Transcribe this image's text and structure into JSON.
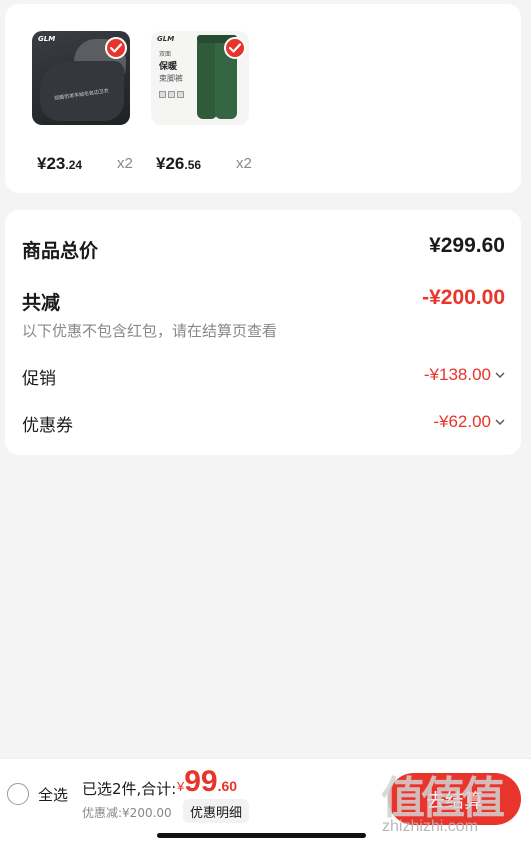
{
  "products": [
    {
      "brand": "GLM",
      "image_caption": "双面仿羔羊绒毛包边卫衣",
      "price_int": "¥23",
      "price_dec": ".24",
      "quantity": "x2",
      "selected": true
    },
    {
      "brand": "GLM",
      "image_tag_1": "双面",
      "image_title": "保暖",
      "image_subtitle": "束脚裤",
      "price_int": "¥26",
      "price_dec": ".56",
      "quantity": "x2",
      "selected": true
    }
  ],
  "summary": {
    "total_label": "商品总价",
    "total_value": "¥299.60",
    "reduce_label": "共减",
    "reduce_value": "-¥200.00",
    "note": "以下优惠不包含红包，请在结算页查看",
    "promo_label": "促销",
    "promo_value": "-¥138.00",
    "coupon_label": "优惠券",
    "coupon_value": "-¥62.00"
  },
  "bottom_bar": {
    "select_all": "全选",
    "selected_text": "已选2件,合计:",
    "total_currency": "¥",
    "total_int": "99",
    "total_dec": ".60",
    "discount_text": "优惠减:¥200.00",
    "detail_button": "优惠明细",
    "checkout_button": "去结算"
  },
  "watermark": {
    "logo": "值值值",
    "url": "zhizhizhi.com"
  },
  "colors": {
    "accent": "#e8342a",
    "background": "#f4f4f4",
    "card": "#ffffff",
    "muted_text": "#888888"
  }
}
